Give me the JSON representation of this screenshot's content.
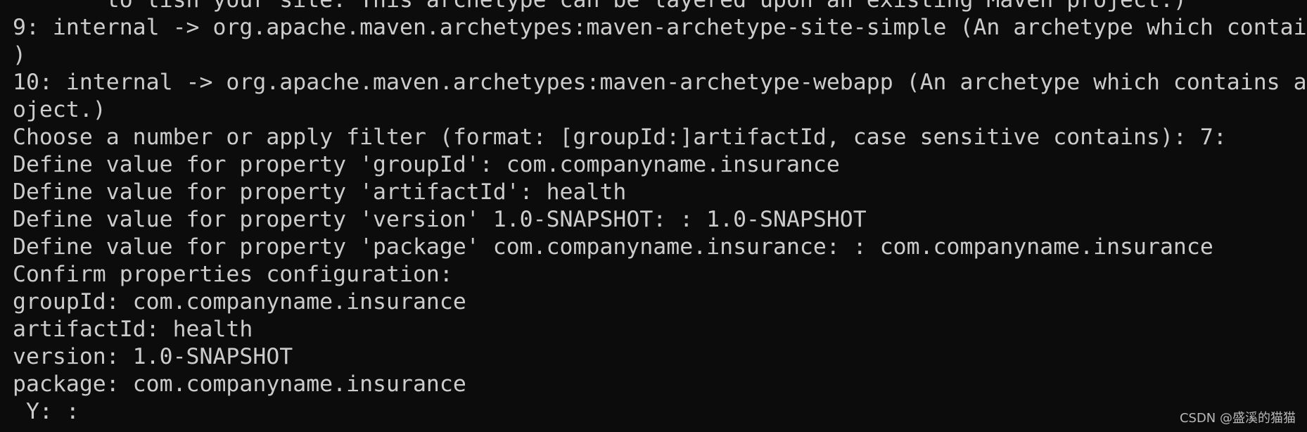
{
  "terminal": {
    "lines": [
      "       to lish your site. This archetype can be layered upon an existing Maven project.)",
      "9: internal -> org.apache.maven.archetypes:maven-archetype-site-simple (An archetype which contai",
      ")",
      "10: internal -> org.apache.maven.archetypes:maven-archetype-webapp (An archetype which contains a",
      "oject.)",
      "Choose a number or apply filter (format: [groupId:]artifactId, case sensitive contains): 7:",
      "Define value for property 'groupId': com.companyname.insurance",
      "Define value for property 'artifactId': health",
      "Define value for property 'version' 1.0-SNAPSHOT: : 1.0-SNAPSHOT",
      "Define value for property 'package' com.companyname.insurance: : com.companyname.insurance",
      "Confirm properties configuration:",
      "groupId: com.companyname.insurance",
      "artifactId: health",
      "version: 1.0-SNAPSHOT",
      "package: com.companyname.insurance",
      " Y: :"
    ]
  },
  "watermark": "CSDN @盛溪的猫猫",
  "colors": {
    "background": "#0c0c0c",
    "foreground": "#cccccc"
  }
}
